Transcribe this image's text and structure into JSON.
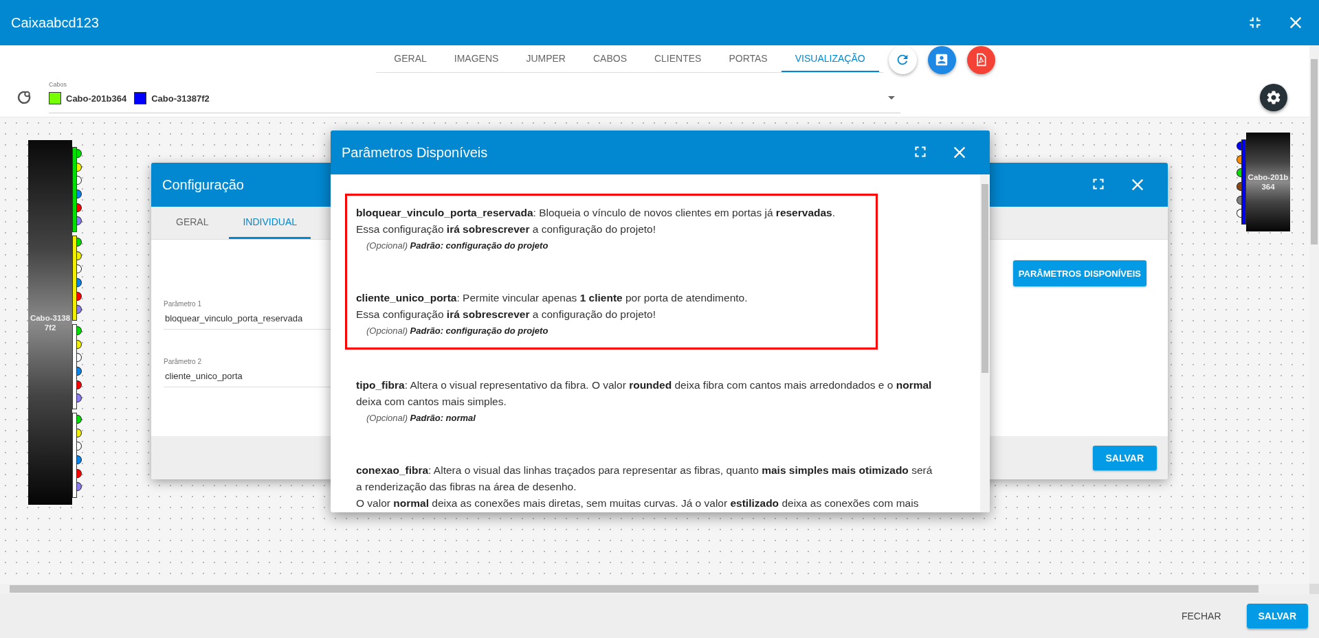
{
  "window": {
    "title": "Caixaabcd123"
  },
  "tabs": [
    {
      "label": "GERAL",
      "selected": false
    },
    {
      "label": "IMAGENS",
      "selected": false
    },
    {
      "label": "JUMPER",
      "selected": false
    },
    {
      "label": "CABOS",
      "selected": false
    },
    {
      "label": "CLIENTES",
      "selected": false
    },
    {
      "label": "PORTAS",
      "selected": false
    },
    {
      "label": "VISUALIZAÇÃO",
      "selected": true
    }
  ],
  "cable_filter": {
    "label": "Cabos",
    "chips": [
      {
        "label": "Cabo-201b364",
        "color": "#76ff03"
      },
      {
        "label": "Cabo-31387f2",
        "color": "#0000ff"
      }
    ]
  },
  "cables": [
    {
      "label": "Cabo-31387f2",
      "tubes": [
        {
          "color": "#00e000",
          "fibers": [
            {
              "color": "#00e000"
            },
            {
              "color": "#f0f000"
            },
            {
              "color": "#ffffff"
            },
            {
              "color": "#0a84e8"
            },
            {
              "color": "#ff0000"
            },
            {
              "color": "#8a7cf0"
            }
          ]
        },
        {
          "color": "#f0f000",
          "fibers": [
            {
              "color": "#00e000"
            },
            {
              "color": "#f0f000"
            },
            {
              "color": "#ffffff"
            },
            {
              "color": "#0a84e8"
            },
            {
              "color": "#ff0000"
            },
            {
              "color": "#8a7cf0"
            }
          ]
        },
        {
          "color": "#ffffff",
          "fibers": [
            {
              "color": "#00e000"
            },
            {
              "color": "#f0f000"
            },
            {
              "color": "#ffffff"
            },
            {
              "color": "#0a84e8"
            },
            {
              "color": "#ff0000"
            },
            {
              "color": "#8a7cf0"
            }
          ]
        },
        {
          "color": "#ffffff",
          "fibers": [
            {
              "color": "#00e000"
            },
            {
              "color": "#f0f000"
            },
            {
              "color": "#ffffff"
            },
            {
              "color": "#0a84e8"
            },
            {
              "color": "#ff0000"
            },
            {
              "color": "#8a7cf0"
            }
          ]
        }
      ]
    },
    {
      "label": "Cabo-201b364",
      "tubes": [
        {
          "color": "#0000ff",
          "fibers": [
            {
              "color": "#0000ff"
            },
            {
              "color": "#ff8c00"
            },
            {
              "color": "#00e000"
            },
            {
              "color": "#8b4513"
            },
            {
              "color": "#808080"
            },
            {
              "color": "#ffffff"
            }
          ]
        }
      ]
    }
  ],
  "config_dialog": {
    "title": "Configuração",
    "tabs": [
      {
        "label": "GERAL",
        "selected": false
      },
      {
        "label": "INDIVIDUAL",
        "selected": true
      }
    ],
    "params_button": "PARÂMETROS DISPONÍVEIS",
    "fields": [
      {
        "label": "Parâmetro 1",
        "value": "bloquear_vinculo_porta_reservada"
      },
      {
        "label": "Parâmetro 2",
        "value": "cliente_unico_porta"
      }
    ],
    "save_button": "SALVAR"
  },
  "params_dialog": {
    "title": "Parâmetros Disponíveis",
    "params": [
      {
        "highlighted": true,
        "lines": [
          "**bloquear_vinculo_porta_reservada**: Bloqueia o vínculo de novos clientes em portas já **reservadas**.",
          "Essa configuração **irá sobrescrever** a configuração do projeto!"
        ],
        "note": "(Opcional) **Padrão: configuração do projeto**"
      },
      {
        "highlighted": true,
        "lines": [
          "**cliente_unico_porta**: Permite vincular apenas **1 cliente** por porta de atendimento.",
          "Essa configuração **irá sobrescrever** a configuração do projeto!"
        ],
        "note": "(Opcional) **Padrão: configuração do projeto**"
      },
      {
        "highlighted": false,
        "lines": [
          "**tipo_fibra**: Altera o visual representativo da fibra. O valor **rounded** deixa fibra com cantos mais arredondados e o **normal** deixa com cantos mais simples."
        ],
        "note": "(Opcional) **Padrão: normal**"
      },
      {
        "highlighted": false,
        "lines": [
          "**conexao_fibra**: Altera o visual das linhas traçados para representar as fibras, quanto **mais simples mais otimizado** será a renderização das fibras na área de desenho.",
          "O valor **normal** deixa as conexões mais diretas, sem muitas curvas. Já o valor **estilizado** deixa as conexões com mais"
        ]
      }
    ]
  },
  "footer": {
    "buttons": [
      {
        "label": "FECHAR",
        "kind": "text"
      },
      {
        "label": "SALVAR",
        "kind": "primary"
      }
    ]
  }
}
